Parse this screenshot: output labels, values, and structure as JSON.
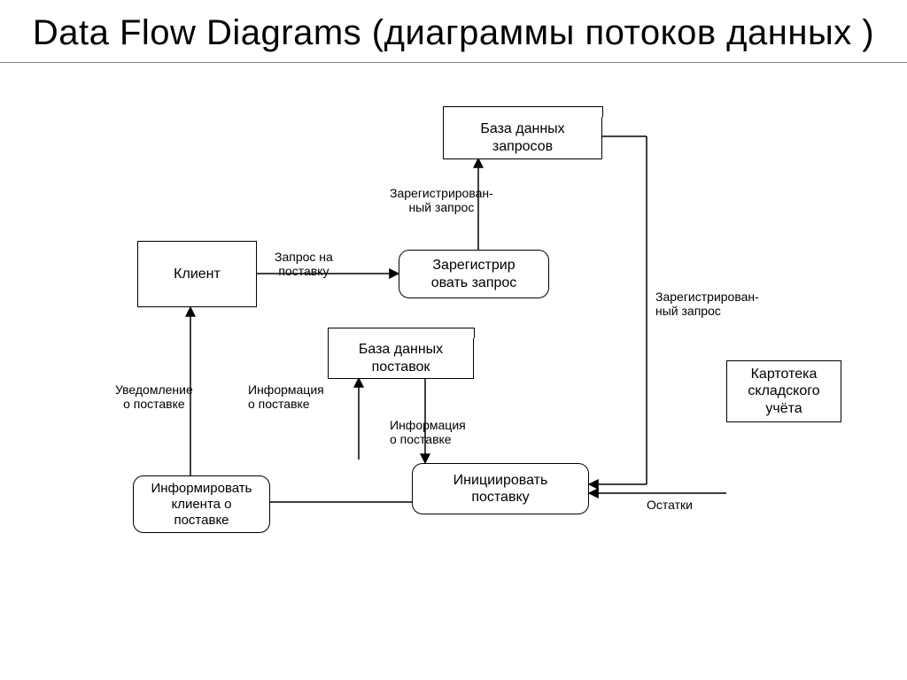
{
  "title": "Data Flow Diagrams (диаграммы потоков данных )",
  "nodes": {
    "client": {
      "text": "Клиент"
    },
    "db_requests": {
      "text": "База данных\nзапросов"
    },
    "db_shipments": {
      "text": "База данных\nпоставок"
    },
    "stock_card": {
      "text": "Картотека\nскладского\nучёта"
    },
    "register_req": {
      "text": "Зарегистрир\nовать запрос"
    },
    "inform_client": {
      "text": "Информировать\nклиента о\nпоставке"
    },
    "init_ship": {
      "text": "Инициировать\nпоставку"
    }
  },
  "flows": {
    "req_ship": "Запрос на\nпоставку",
    "reg_req_up": "Зарегистрирован-\nный запрос",
    "reg_req_right": "Зарегистрирован-\nный запрос",
    "info_ship_up": "Информация\nо поставке",
    "info_ship_down": "Информация\nо поставке",
    "notify_ship": "Уведомление\nо поставке",
    "leftovers": "Остатки"
  }
}
